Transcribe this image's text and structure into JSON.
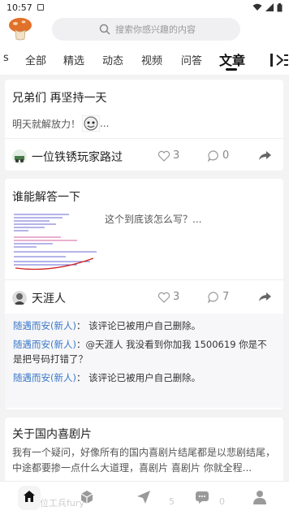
{
  "status_bar": {
    "time": "10:57"
  },
  "search": {
    "placeholder": "搜索你感兴趣的内容"
  },
  "tabs": {
    "partial_left": "s",
    "items": [
      "全部",
      "精选",
      "动态",
      "视频",
      "问答",
      "文章"
    ],
    "active": "文章"
  },
  "posts": [
    {
      "title": "兄弟们 再坚持一天",
      "desc": "明天就解放力！",
      "desc_suffix": "...",
      "author": "一位铁锈玩家路过",
      "likes": "3",
      "comments": "0"
    },
    {
      "title": "谁能解答一下",
      "desc": "这个到底该怎么写？...",
      "author": "天涯人",
      "likes": "3",
      "comments": "7",
      "comment_list": [
        {
          "name": "随遇而安(新人)",
          "sep": "：",
          "text": "该评论已被用户自己删除。"
        },
        {
          "name": "随遇而安(新人)",
          "sep": "：",
          "text": "@天涯人 我没看到你加我 1500619 你是不是把号码打错了？"
        },
        {
          "name": "随遇而安(新人)",
          "sep": "：",
          "text": "该评论已被用户自己删除。"
        }
      ]
    },
    {
      "title": "关于国内喜剧片",
      "desc": "我有一个疑问，好像所有的国内喜剧片结尾都是以悲剧结尾，中途都要掺一点什么大道理，喜剧片 喜剧片 你就全程..."
    }
  ],
  "bottom_nav": {
    "ghost_author": "一位工兵fury",
    "ghost_likes": "5",
    "ghost_comments": "0"
  }
}
